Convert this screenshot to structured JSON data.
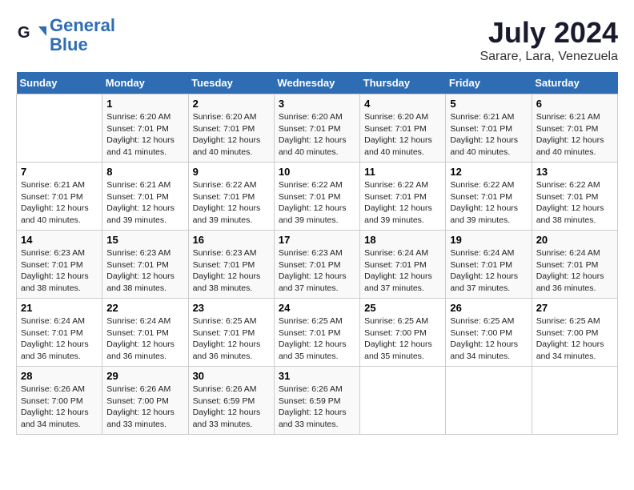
{
  "header": {
    "logo_line1": "General",
    "logo_line2": "Blue",
    "month": "July 2024",
    "location": "Sarare, Lara, Venezuela"
  },
  "days_of_week": [
    "Sunday",
    "Monday",
    "Tuesday",
    "Wednesday",
    "Thursday",
    "Friday",
    "Saturday"
  ],
  "weeks": [
    [
      {
        "day": "",
        "text": ""
      },
      {
        "day": "1",
        "text": "Sunrise: 6:20 AM\nSunset: 7:01 PM\nDaylight: 12 hours and 41 minutes."
      },
      {
        "day": "2",
        "text": "Sunrise: 6:20 AM\nSunset: 7:01 PM\nDaylight: 12 hours and 40 minutes."
      },
      {
        "day": "3",
        "text": "Sunrise: 6:20 AM\nSunset: 7:01 PM\nDaylight: 12 hours and 40 minutes."
      },
      {
        "day": "4",
        "text": "Sunrise: 6:20 AM\nSunset: 7:01 PM\nDaylight: 12 hours and 40 minutes."
      },
      {
        "day": "5",
        "text": "Sunrise: 6:21 AM\nSunset: 7:01 PM\nDaylight: 12 hours and 40 minutes."
      },
      {
        "day": "6",
        "text": "Sunrise: 6:21 AM\nSunset: 7:01 PM\nDaylight: 12 hours and 40 minutes."
      }
    ],
    [
      {
        "day": "7",
        "text": "Sunrise: 6:21 AM\nSunset: 7:01 PM\nDaylight: 12 hours and 40 minutes."
      },
      {
        "day": "8",
        "text": "Sunrise: 6:21 AM\nSunset: 7:01 PM\nDaylight: 12 hours and 39 minutes."
      },
      {
        "day": "9",
        "text": "Sunrise: 6:22 AM\nSunset: 7:01 PM\nDaylight: 12 hours and 39 minutes."
      },
      {
        "day": "10",
        "text": "Sunrise: 6:22 AM\nSunset: 7:01 PM\nDaylight: 12 hours and 39 minutes."
      },
      {
        "day": "11",
        "text": "Sunrise: 6:22 AM\nSunset: 7:01 PM\nDaylight: 12 hours and 39 minutes."
      },
      {
        "day": "12",
        "text": "Sunrise: 6:22 AM\nSunset: 7:01 PM\nDaylight: 12 hours and 39 minutes."
      },
      {
        "day": "13",
        "text": "Sunrise: 6:22 AM\nSunset: 7:01 PM\nDaylight: 12 hours and 38 minutes."
      }
    ],
    [
      {
        "day": "14",
        "text": "Sunrise: 6:23 AM\nSunset: 7:01 PM\nDaylight: 12 hours and 38 minutes."
      },
      {
        "day": "15",
        "text": "Sunrise: 6:23 AM\nSunset: 7:01 PM\nDaylight: 12 hours and 38 minutes."
      },
      {
        "day": "16",
        "text": "Sunrise: 6:23 AM\nSunset: 7:01 PM\nDaylight: 12 hours and 38 minutes."
      },
      {
        "day": "17",
        "text": "Sunrise: 6:23 AM\nSunset: 7:01 PM\nDaylight: 12 hours and 37 minutes."
      },
      {
        "day": "18",
        "text": "Sunrise: 6:24 AM\nSunset: 7:01 PM\nDaylight: 12 hours and 37 minutes."
      },
      {
        "day": "19",
        "text": "Sunrise: 6:24 AM\nSunset: 7:01 PM\nDaylight: 12 hours and 37 minutes."
      },
      {
        "day": "20",
        "text": "Sunrise: 6:24 AM\nSunset: 7:01 PM\nDaylight: 12 hours and 36 minutes."
      }
    ],
    [
      {
        "day": "21",
        "text": "Sunrise: 6:24 AM\nSunset: 7:01 PM\nDaylight: 12 hours and 36 minutes."
      },
      {
        "day": "22",
        "text": "Sunrise: 6:24 AM\nSunset: 7:01 PM\nDaylight: 12 hours and 36 minutes."
      },
      {
        "day": "23",
        "text": "Sunrise: 6:25 AM\nSunset: 7:01 PM\nDaylight: 12 hours and 36 minutes."
      },
      {
        "day": "24",
        "text": "Sunrise: 6:25 AM\nSunset: 7:01 PM\nDaylight: 12 hours and 35 minutes."
      },
      {
        "day": "25",
        "text": "Sunrise: 6:25 AM\nSunset: 7:00 PM\nDaylight: 12 hours and 35 minutes."
      },
      {
        "day": "26",
        "text": "Sunrise: 6:25 AM\nSunset: 7:00 PM\nDaylight: 12 hours and 34 minutes."
      },
      {
        "day": "27",
        "text": "Sunrise: 6:25 AM\nSunset: 7:00 PM\nDaylight: 12 hours and 34 minutes."
      }
    ],
    [
      {
        "day": "28",
        "text": "Sunrise: 6:26 AM\nSunset: 7:00 PM\nDaylight: 12 hours and 34 minutes."
      },
      {
        "day": "29",
        "text": "Sunrise: 6:26 AM\nSunset: 7:00 PM\nDaylight: 12 hours and 33 minutes."
      },
      {
        "day": "30",
        "text": "Sunrise: 6:26 AM\nSunset: 6:59 PM\nDaylight: 12 hours and 33 minutes."
      },
      {
        "day": "31",
        "text": "Sunrise: 6:26 AM\nSunset: 6:59 PM\nDaylight: 12 hours and 33 minutes."
      },
      {
        "day": "",
        "text": ""
      },
      {
        "day": "",
        "text": ""
      },
      {
        "day": "",
        "text": ""
      }
    ]
  ]
}
